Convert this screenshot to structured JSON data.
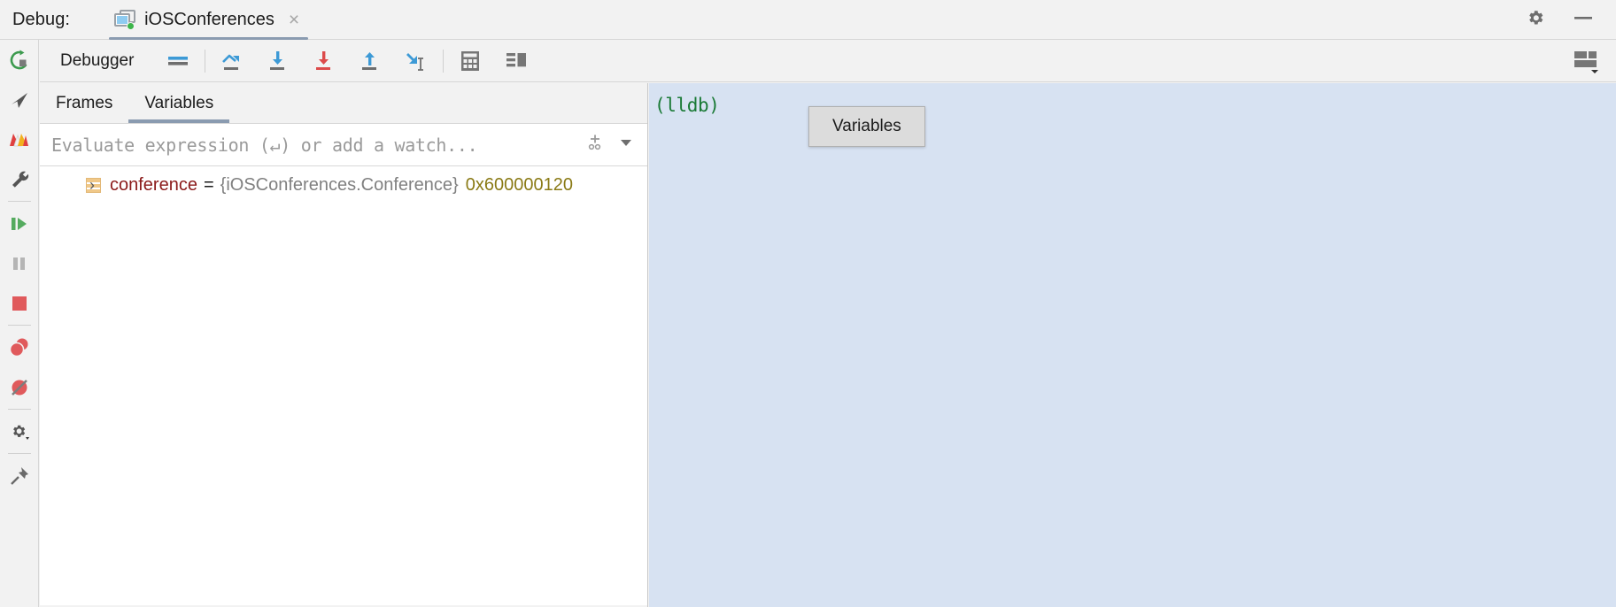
{
  "titlebar": {
    "debug_label": "Debug:",
    "tab": {
      "title": "iOSConferences",
      "close_label": "×",
      "icon_name": "app-window-icon",
      "running_dot_color": "#3cb54a"
    },
    "gear_icon": "gear-icon",
    "minimize_icon": "minimize-icon"
  },
  "rail": {
    "items": [
      {
        "name": "rerun-icon",
        "label": "Rerun"
      },
      {
        "name": "cursor-arrow-icon",
        "label": "Select"
      },
      {
        "name": "layers-icon",
        "label": "Layers"
      },
      {
        "name": "wrench-icon",
        "label": "Settings"
      },
      {
        "name": "resume-icon",
        "label": "Resume Program"
      },
      {
        "name": "pause-icon",
        "label": "Pause Program"
      },
      {
        "name": "stop-icon",
        "label": "Stop"
      },
      {
        "name": "breakpoints-icon",
        "label": "View Breakpoints"
      },
      {
        "name": "mute-breakpoints-icon",
        "label": "Mute Breakpoints"
      },
      {
        "name": "settings-gear-icon",
        "label": "Settings"
      },
      {
        "name": "pin-icon",
        "label": "Pin Tab"
      }
    ]
  },
  "toolbar": {
    "title": "Debugger",
    "buttons": [
      {
        "name": "show-execution-point-icon",
        "label": "Show Execution Point"
      },
      {
        "name": "step-over-icon",
        "label": "Step Over"
      },
      {
        "name": "step-into-icon",
        "label": "Step Into"
      },
      {
        "name": "force-step-into-icon",
        "label": "Force Step Into"
      },
      {
        "name": "step-out-icon",
        "label": "Step Out"
      },
      {
        "name": "run-to-cursor-icon",
        "label": "Run to Cursor"
      },
      {
        "name": "evaluate-expression-icon",
        "label": "Evaluate Expression"
      },
      {
        "name": "layout-settings-icon",
        "label": "Layout Settings"
      }
    ],
    "right_icon": "layout-toggle-icon"
  },
  "panel": {
    "tabs": [
      {
        "label": "Frames",
        "active": false
      },
      {
        "label": "Variables",
        "active": true
      }
    ],
    "evaluate": {
      "placeholder": "Evaluate expression (↵) or add a watch...",
      "value": "",
      "add_watch_icon": "add-watch-icon",
      "dropdown_icon": "chevron-down-icon"
    },
    "variables": [
      {
        "expander": "›",
        "icon": "variable-icon",
        "name": "conference",
        "equals": "=",
        "type": "{iOSConferences.Conference}",
        "address": "0x600000120"
      }
    ]
  },
  "console": {
    "prompt": "(lldb)",
    "prompt_color": "#1a7a36",
    "background": "#d7e2f2",
    "tooltip": {
      "text": "Variables"
    }
  }
}
